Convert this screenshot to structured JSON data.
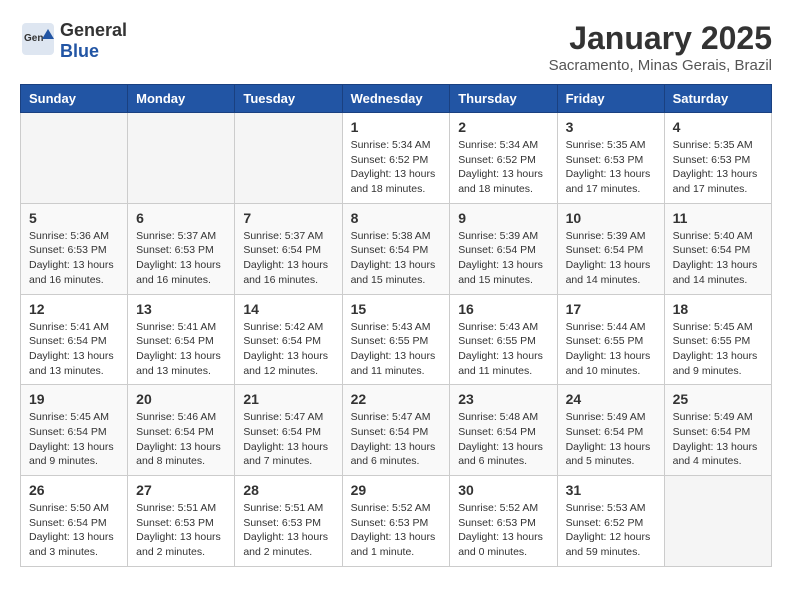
{
  "logo": {
    "general": "General",
    "blue": "Blue"
  },
  "header": {
    "title": "January 2025",
    "subtitle": "Sacramento, Minas Gerais, Brazil"
  },
  "weekdays": [
    "Sunday",
    "Monday",
    "Tuesday",
    "Wednesday",
    "Thursday",
    "Friday",
    "Saturday"
  ],
  "weeks": [
    [
      {
        "day": "",
        "info": ""
      },
      {
        "day": "",
        "info": ""
      },
      {
        "day": "",
        "info": ""
      },
      {
        "day": "1",
        "info": "Sunrise: 5:34 AM\nSunset: 6:52 PM\nDaylight: 13 hours\nand 18 minutes."
      },
      {
        "day": "2",
        "info": "Sunrise: 5:34 AM\nSunset: 6:52 PM\nDaylight: 13 hours\nand 18 minutes."
      },
      {
        "day": "3",
        "info": "Sunrise: 5:35 AM\nSunset: 6:53 PM\nDaylight: 13 hours\nand 17 minutes."
      },
      {
        "day": "4",
        "info": "Sunrise: 5:35 AM\nSunset: 6:53 PM\nDaylight: 13 hours\nand 17 minutes."
      }
    ],
    [
      {
        "day": "5",
        "info": "Sunrise: 5:36 AM\nSunset: 6:53 PM\nDaylight: 13 hours\nand 16 minutes."
      },
      {
        "day": "6",
        "info": "Sunrise: 5:37 AM\nSunset: 6:53 PM\nDaylight: 13 hours\nand 16 minutes."
      },
      {
        "day": "7",
        "info": "Sunrise: 5:37 AM\nSunset: 6:54 PM\nDaylight: 13 hours\nand 16 minutes."
      },
      {
        "day": "8",
        "info": "Sunrise: 5:38 AM\nSunset: 6:54 PM\nDaylight: 13 hours\nand 15 minutes."
      },
      {
        "day": "9",
        "info": "Sunrise: 5:39 AM\nSunset: 6:54 PM\nDaylight: 13 hours\nand 15 minutes."
      },
      {
        "day": "10",
        "info": "Sunrise: 5:39 AM\nSunset: 6:54 PM\nDaylight: 13 hours\nand 14 minutes."
      },
      {
        "day": "11",
        "info": "Sunrise: 5:40 AM\nSunset: 6:54 PM\nDaylight: 13 hours\nand 14 minutes."
      }
    ],
    [
      {
        "day": "12",
        "info": "Sunrise: 5:41 AM\nSunset: 6:54 PM\nDaylight: 13 hours\nand 13 minutes."
      },
      {
        "day": "13",
        "info": "Sunrise: 5:41 AM\nSunset: 6:54 PM\nDaylight: 13 hours\nand 13 minutes."
      },
      {
        "day": "14",
        "info": "Sunrise: 5:42 AM\nSunset: 6:54 PM\nDaylight: 13 hours\nand 12 minutes."
      },
      {
        "day": "15",
        "info": "Sunrise: 5:43 AM\nSunset: 6:55 PM\nDaylight: 13 hours\nand 11 minutes."
      },
      {
        "day": "16",
        "info": "Sunrise: 5:43 AM\nSunset: 6:55 PM\nDaylight: 13 hours\nand 11 minutes."
      },
      {
        "day": "17",
        "info": "Sunrise: 5:44 AM\nSunset: 6:55 PM\nDaylight: 13 hours\nand 10 minutes."
      },
      {
        "day": "18",
        "info": "Sunrise: 5:45 AM\nSunset: 6:55 PM\nDaylight: 13 hours\nand 9 minutes."
      }
    ],
    [
      {
        "day": "19",
        "info": "Sunrise: 5:45 AM\nSunset: 6:54 PM\nDaylight: 13 hours\nand 9 minutes."
      },
      {
        "day": "20",
        "info": "Sunrise: 5:46 AM\nSunset: 6:54 PM\nDaylight: 13 hours\nand 8 minutes."
      },
      {
        "day": "21",
        "info": "Sunrise: 5:47 AM\nSunset: 6:54 PM\nDaylight: 13 hours\nand 7 minutes."
      },
      {
        "day": "22",
        "info": "Sunrise: 5:47 AM\nSunset: 6:54 PM\nDaylight: 13 hours\nand 6 minutes."
      },
      {
        "day": "23",
        "info": "Sunrise: 5:48 AM\nSunset: 6:54 PM\nDaylight: 13 hours\nand 6 minutes."
      },
      {
        "day": "24",
        "info": "Sunrise: 5:49 AM\nSunset: 6:54 PM\nDaylight: 13 hours\nand 5 minutes."
      },
      {
        "day": "25",
        "info": "Sunrise: 5:49 AM\nSunset: 6:54 PM\nDaylight: 13 hours\nand 4 minutes."
      }
    ],
    [
      {
        "day": "26",
        "info": "Sunrise: 5:50 AM\nSunset: 6:54 PM\nDaylight: 13 hours\nand 3 minutes."
      },
      {
        "day": "27",
        "info": "Sunrise: 5:51 AM\nSunset: 6:53 PM\nDaylight: 13 hours\nand 2 minutes."
      },
      {
        "day": "28",
        "info": "Sunrise: 5:51 AM\nSunset: 6:53 PM\nDaylight: 13 hours\nand 2 minutes."
      },
      {
        "day": "29",
        "info": "Sunrise: 5:52 AM\nSunset: 6:53 PM\nDaylight: 13 hours\nand 1 minute."
      },
      {
        "day": "30",
        "info": "Sunrise: 5:52 AM\nSunset: 6:53 PM\nDaylight: 13 hours\nand 0 minutes."
      },
      {
        "day": "31",
        "info": "Sunrise: 5:53 AM\nSunset: 6:52 PM\nDaylight: 12 hours\nand 59 minutes."
      },
      {
        "day": "",
        "info": ""
      }
    ]
  ]
}
